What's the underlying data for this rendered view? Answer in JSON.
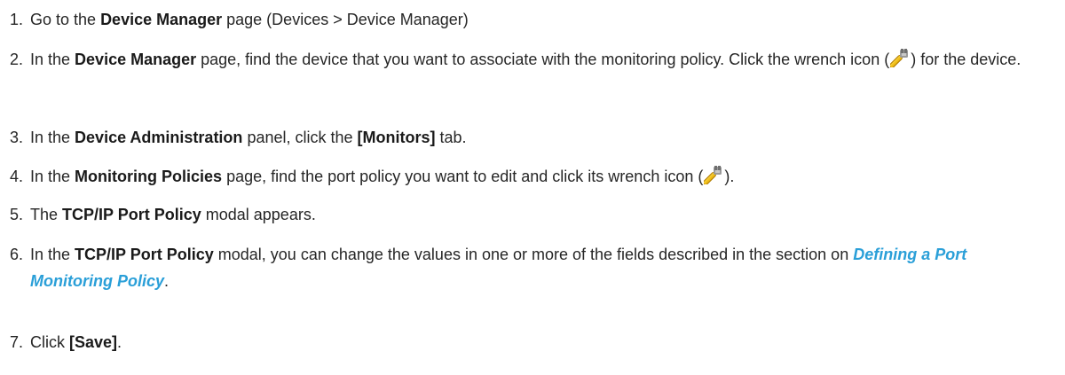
{
  "steps": [
    {
      "number": "1.",
      "pre": "Go to the ",
      "bold": "Device Manager",
      "post": " page (Devices > Device Manager)"
    },
    {
      "number": "2.",
      "pre": "In the ",
      "bold": "Device Manager",
      "mid": " page, find the device that you want to associate with the monitoring policy. Click the wrench icon (",
      "icon": "wrench-icon",
      "post": ") for the device."
    },
    {
      "number": "3.",
      "pre": "In the ",
      "bold": "Device Administration",
      "mid": " panel, click the ",
      "bold2": "[Monitors]",
      "post": " tab."
    },
    {
      "number": "4.",
      "pre": "In the ",
      "bold": "Monitoring Policies",
      "mid": " page, find the port policy you want to edit and click its wrench icon (",
      "icon": "wrench-icon",
      "post": ")."
    },
    {
      "number": "5.",
      "pre": "The ",
      "bold": "TCP/IP Port Policy",
      "post": " modal appears."
    },
    {
      "number": "6.",
      "pre": "In the ",
      "bold": "TCP/IP Port Policy",
      "mid": " modal, you can change the values in one or more of the fields described in the section on ",
      "link": "Defining a Port Monitoring Policy",
      "post": "."
    },
    {
      "number": "7.",
      "pre": "Click ",
      "bold": "[Save]",
      "post": "."
    }
  ]
}
